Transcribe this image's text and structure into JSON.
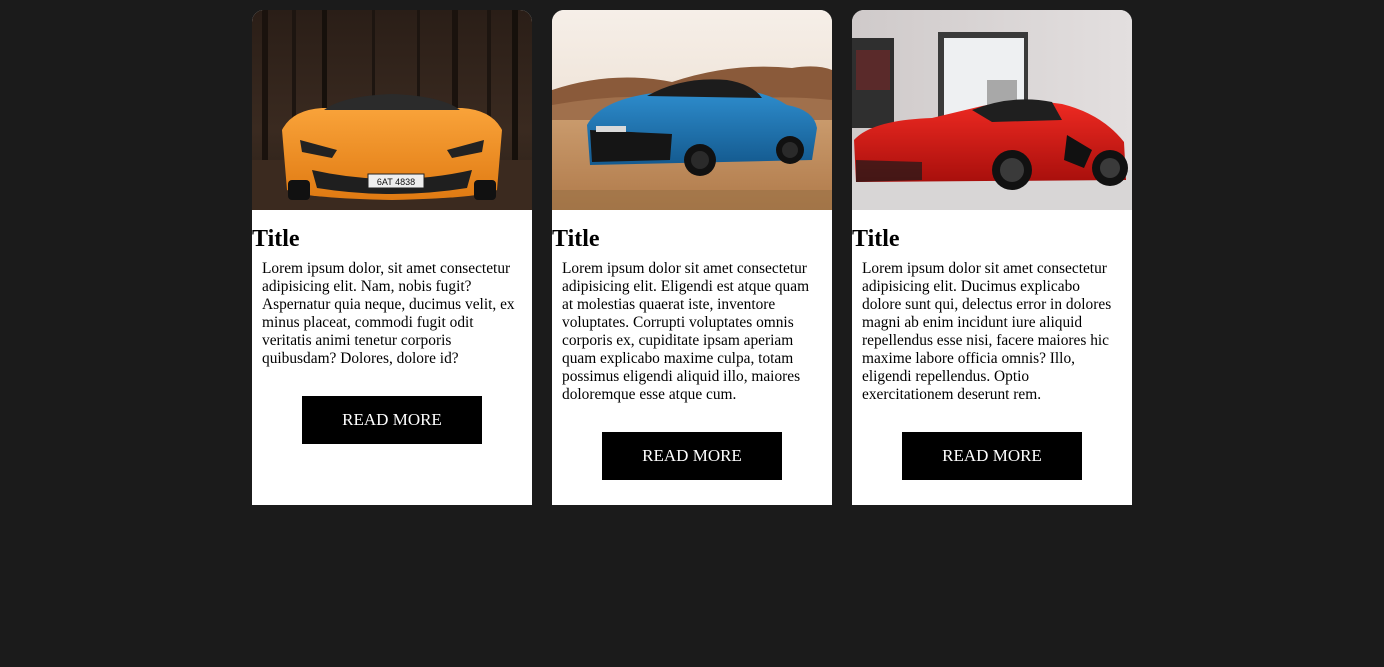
{
  "cards": [
    {
      "image_alt": "orange sports car in forest",
      "title": "Title",
      "text": "Lorem ipsum dolor, sit amet consectetur adipisicing elit. Nam, nobis fugit? Aspernatur quia neque, ducimus velit, ex minus placeat, commodi fugit odit veritatis animi tenetur corporis quibusdam? Dolores, dolore id?",
      "button_label": "READ MORE",
      "license_plate": "6AT 4838"
    },
    {
      "image_alt": "blue muscle car in desert",
      "title": "Title",
      "text": "Lorem ipsum dolor sit amet consectetur adipisicing elit. Eligendi est atque quam at molestias quaerat iste, inventore voluptates. Corrupti voluptates omnis corporis ex, cupiditate ipsam aperiam quam explicabo maxime culpa, totam possimus eligendi aliquid illo, maiores doloremque esse atque cum.",
      "button_label": "READ MORE"
    },
    {
      "image_alt": "red supercar in showroom",
      "title": "Title",
      "text": "Lorem ipsum dolor sit amet consectetur adipisicing elit. Ducimus explicabo dolore sunt qui, delectus error in dolores magni ab enim incidunt iure aliquid repellendus esse nisi, facere maiores hic maxime labore officia omnis? Illo, eligendi repellendus. Optio exercitationem deserunt rem.",
      "button_label": "READ MORE"
    }
  ]
}
